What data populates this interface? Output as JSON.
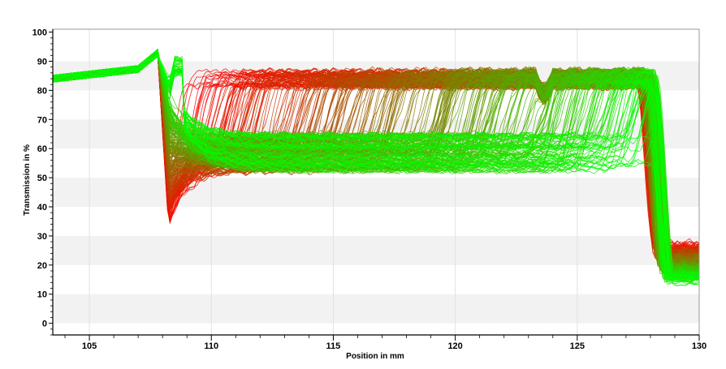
{
  "chart_data": {
    "type": "line",
    "title": "",
    "xlabel": "Position in mm",
    "ylabel": "Transmission in %",
    "xlim": [
      103.5,
      130
    ],
    "ylim": [
      -4,
      101
    ],
    "x_ticks": [
      105,
      110,
      115,
      120,
      125,
      130
    ],
    "y_ticks": [
      0,
      10,
      20,
      30,
      40,
      50,
      60,
      70,
      80,
      90,
      100
    ],
    "grid": true,
    "legend": "none",
    "series_count": 320,
    "color_start": "#ff0000",
    "color_end": "#00ff00",
    "representative_series": [
      {
        "x": [
          103.5,
          104.5,
          105.5,
          106.5,
          107.5,
          107.9,
          108.1,
          108.3,
          108.6,
          109,
          110,
          112,
          115,
          118,
          121,
          124,
          126,
          127.3,
          127.8,
          128.1,
          128.5,
          129,
          130
        ],
        "y": [
          84,
          85,
          86,
          87,
          88,
          92,
          72,
          38,
          46,
          50,
          53,
          56,
          56,
          56,
          56,
          55,
          55,
          52,
          44,
          28,
          22,
          20,
          20
        ]
      },
      {
        "x": [
          103.5,
          104.5,
          105.5,
          106.5,
          107.5,
          107.9,
          108.1,
          108.3,
          108.6,
          109,
          110,
          112,
          115,
          118,
          121,
          124,
          126,
          127.3,
          127.8,
          128.1,
          128.5,
          129,
          130
        ],
        "y": [
          84,
          85,
          86,
          87,
          88,
          92,
          72,
          55,
          65,
          70,
          72,
          68,
          66,
          64,
          63,
          62,
          61,
          58,
          48,
          30,
          22,
          19,
          19
        ]
      },
      {
        "x": [
          103.5,
          104.5,
          105.5,
          106.5,
          107.5,
          107.9,
          108.1,
          108.3,
          108.6,
          109,
          110,
          112,
          115,
          118,
          121,
          124,
          126,
          127.3,
          127.8,
          128.1,
          128.5,
          129,
          130
        ],
        "y": [
          84,
          85,
          86,
          87,
          88,
          90,
          72,
          89,
          84,
          83,
          83,
          84,
          84,
          85,
          85,
          85,
          86,
          85,
          60,
          30,
          15,
          14,
          15
        ]
      }
    ]
  },
  "colors": {
    "grid_band": "#f2f2f2",
    "axis": "#000000"
  }
}
